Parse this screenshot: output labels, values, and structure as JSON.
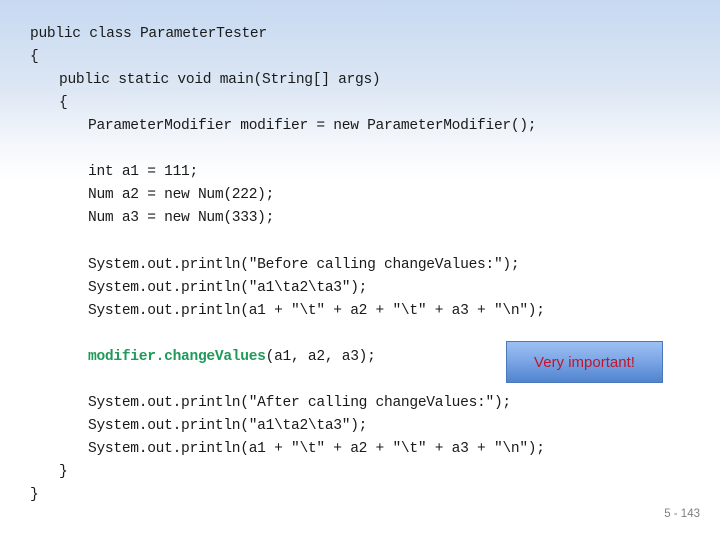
{
  "slide": {
    "code_lines": [
      "public class ParameterTester",
      "{",
      "public static void main(String[] args)",
      "{",
      "ParameterModifier modifier = new ParameterModifier();",
      "int a1 = 111;",
      "Num a2 = new Num(222);",
      "Num a3 = new Num(333);",
      "System.out.println(\"Before calling changeValues:\");",
      "System.out.println(\"a1\\ta2\\ta3\");",
      "System.out.println(a1 + \"\\t\" + a2 + \"\\t\" + a3 + \"\\n\");",
      "System.out.println(\"After calling changeValues:\");",
      "System.out.println(\"a1\\ta2\\ta3\");",
      "System.out.println(a1 + \"\\t\" + a2 + \"\\t\" + a3 + \"\\n\");",
      "}",
      "}"
    ],
    "highlighted_call": {
      "method": "modifier.changeValues",
      "args": "(a1, a2, a3);",
      "highlight_color": "#1f9a5b"
    },
    "callout": {
      "label": "Very important!",
      "text_color": "#c0152a",
      "box_color": "#7ea7e6"
    },
    "page_number": "5 - 143"
  }
}
